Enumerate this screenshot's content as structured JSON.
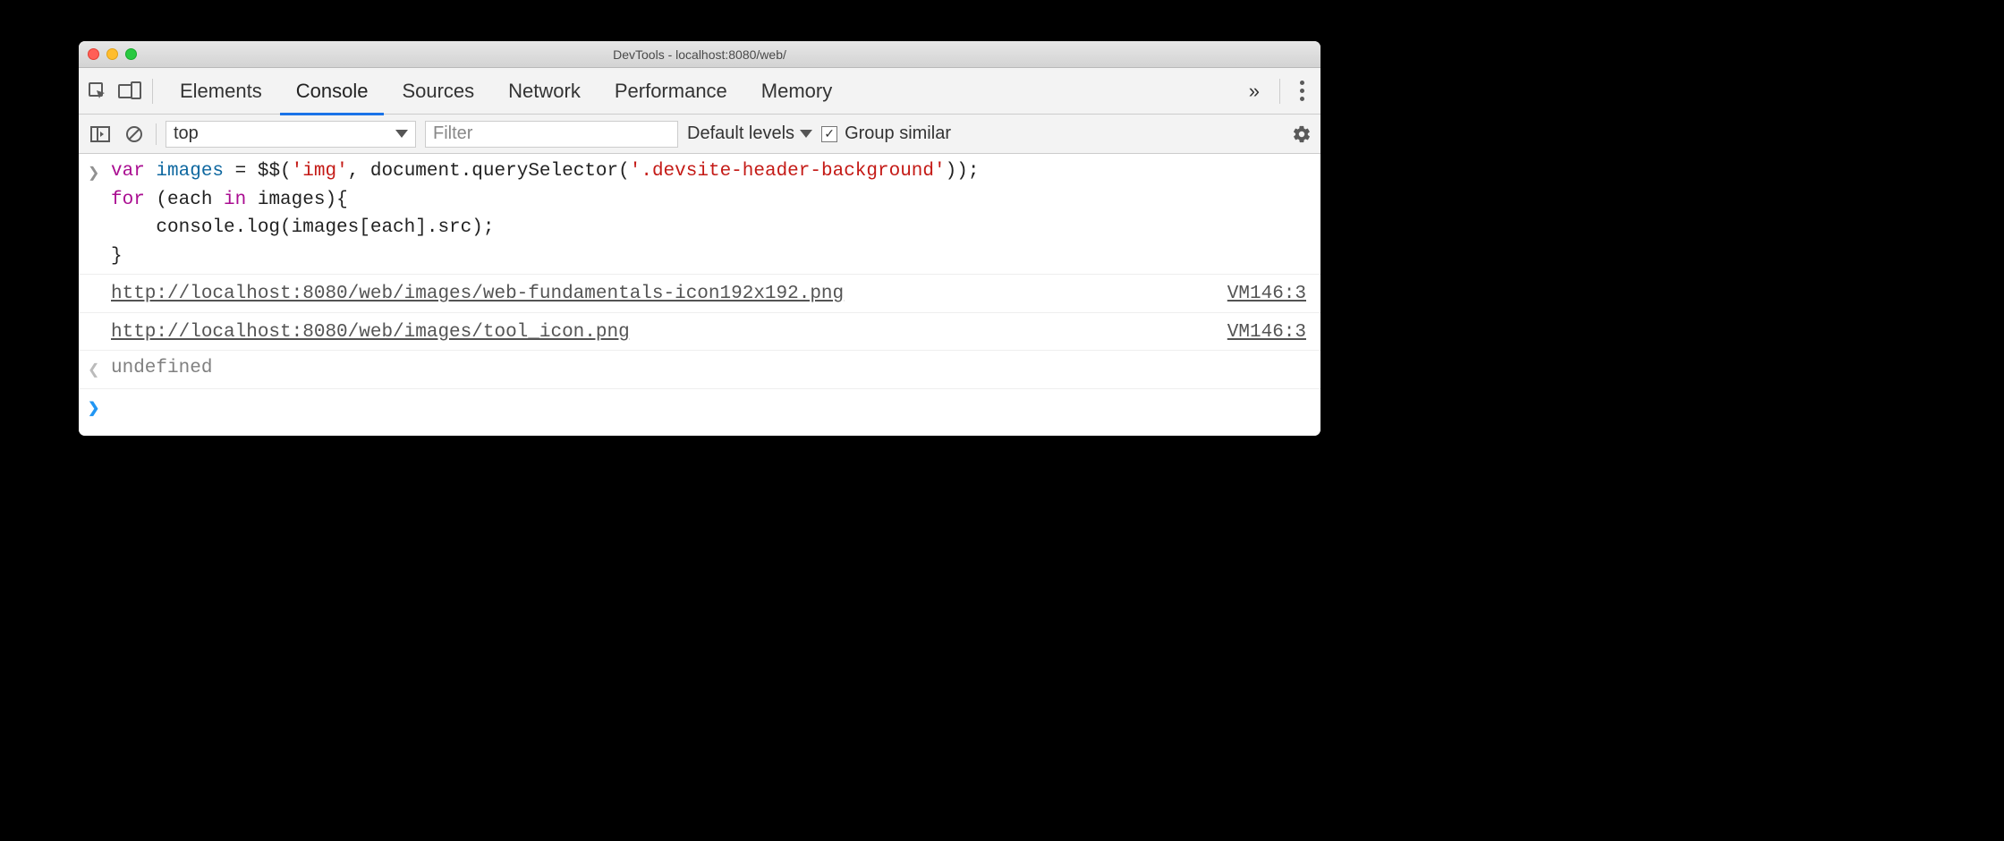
{
  "window": {
    "title": "DevTools - localhost:8080/web/"
  },
  "tabs": {
    "items": [
      "Elements",
      "Console",
      "Sources",
      "Network",
      "Performance",
      "Memory"
    ],
    "active": "Console",
    "overflow_glyph": "»"
  },
  "filterbar": {
    "context": "top",
    "filter_placeholder": "Filter",
    "levels_label": "Default levels",
    "group_similar_label": "Group similar",
    "group_similar_checked": true
  },
  "code": {
    "line1_kw_var": "var",
    "line1_id": "images",
    "line1_eq": " = $$(",
    "line1_str1": "'img'",
    "line1_mid": ", document.querySelector(",
    "line1_str2": "'.devsite-header-background'",
    "line1_end": "));",
    "line2_kw_for": "for",
    "line2_paren": " (each ",
    "line2_kw_in": "in",
    "line2_rest": " images){",
    "line3": "    console.log(images[each].src);",
    "line4": "}"
  },
  "outputs": [
    {
      "url": "http://localhost:8080/web/images/web-fundamentals-icon192x192.png",
      "source": "VM146:3"
    },
    {
      "url": "http://localhost:8080/web/images/tool_icon.png",
      "source": "VM146:3"
    }
  ],
  "return_value": "undefined"
}
